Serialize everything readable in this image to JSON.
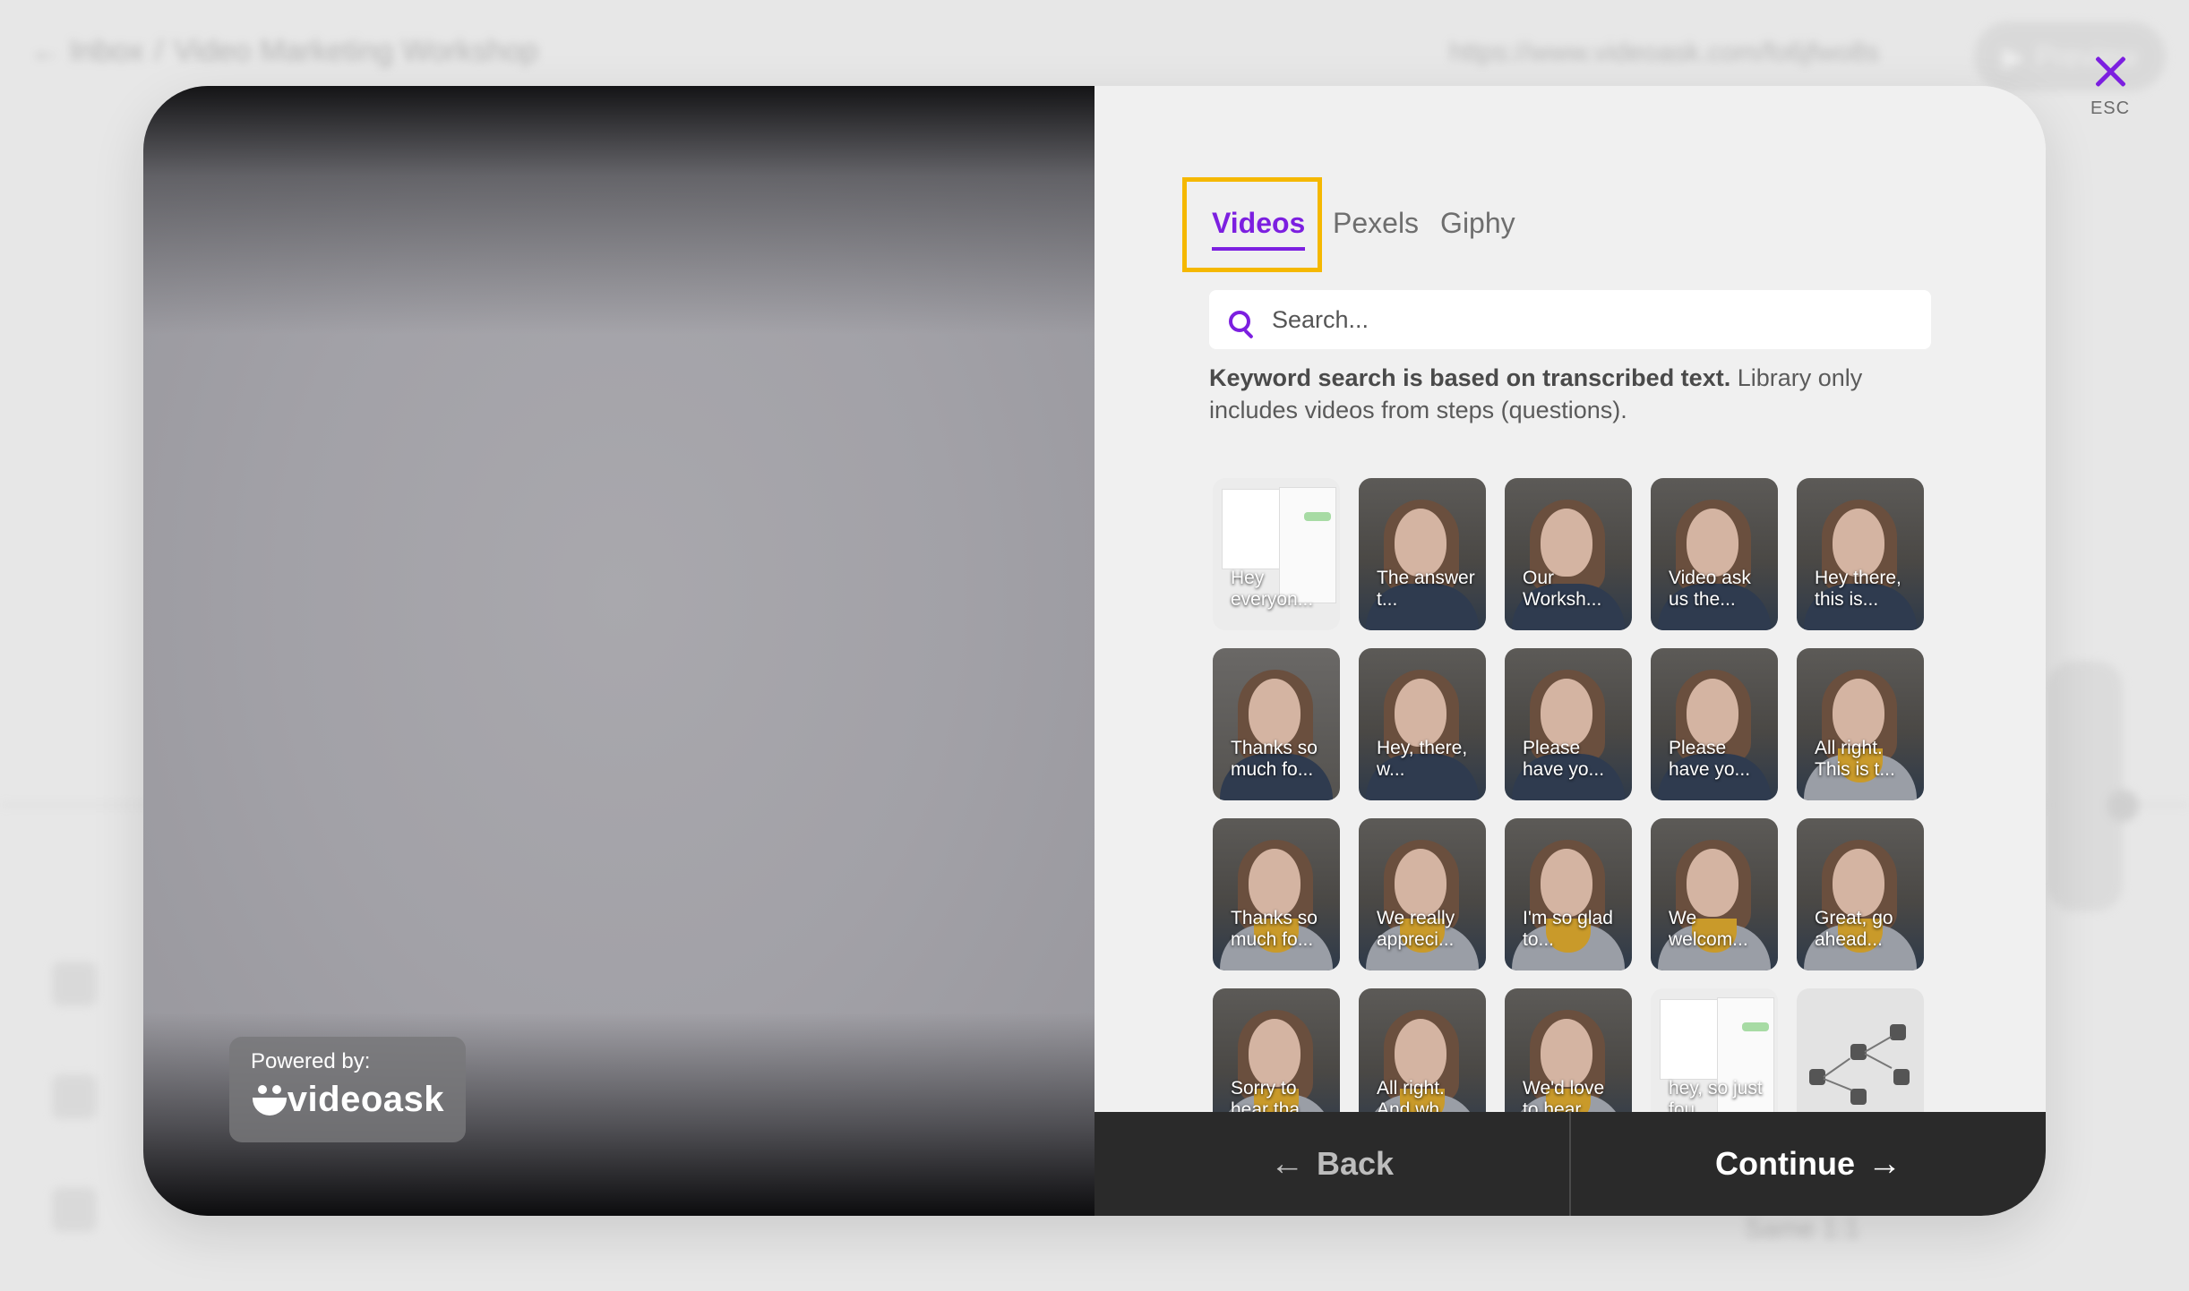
{
  "background": {
    "breadcrumb_back": "← Inbox",
    "breadcrumb_sep": "/",
    "breadcrumb_title": "Video Marketing Workshop",
    "share_url": "https://www.videoask.com/fo6jfwo8s",
    "preview_label": "Preview",
    "zoom_label": "Same 1:1"
  },
  "close": {
    "label": "ESC"
  },
  "video_pane": {
    "powered_by_label": "Powered by:",
    "brand_name": "videoask"
  },
  "tabs": [
    {
      "label": "Videos",
      "active": true
    },
    {
      "label": "Pexels",
      "active": false
    },
    {
      "label": "Giphy",
      "active": false
    }
  ],
  "search": {
    "placeholder": "Search...",
    "value": ""
  },
  "help": {
    "bold": "Keyword search is based on transcribed text.",
    "text": " Library only includes videos from steps (questions)."
  },
  "videos": [
    {
      "caption": "Hey everyon...",
      "kind": "shot"
    },
    {
      "caption": "The answer t...",
      "kind": "dark"
    },
    {
      "caption": "Our Worksh...",
      "kind": "dark"
    },
    {
      "caption": "Video ask us the...",
      "kind": "dark"
    },
    {
      "caption": "Hey there, this is...",
      "kind": "dark"
    },
    {
      "caption": "Thanks so much fo...",
      "kind": "shade"
    },
    {
      "caption": "Hey, there, w...",
      "kind": "dark"
    },
    {
      "caption": "Please have yo...",
      "kind": "dark"
    },
    {
      "caption": "Please have yo...",
      "kind": "dark"
    },
    {
      "caption": "All right. This is t...",
      "kind": "mustard"
    },
    {
      "caption": "Thanks so much fo...",
      "kind": "mustard"
    },
    {
      "caption": "We really appreci...",
      "kind": "mustard"
    },
    {
      "caption": "I'm so glad to...",
      "kind": "mustard"
    },
    {
      "caption": "We welcom...",
      "kind": "mustard"
    },
    {
      "caption": "Great, go ahead...",
      "kind": "mustard"
    },
    {
      "caption": "Sorry to hear tha...",
      "kind": "mustard"
    },
    {
      "caption": "All right. And wh...",
      "kind": "mustard"
    },
    {
      "caption": "We'd love to hear...",
      "kind": "mustard"
    },
    {
      "caption": "hey, so just fou...",
      "kind": "shot"
    },
    {
      "caption": "",
      "kind": "diagram"
    }
  ],
  "footer": {
    "back_label": "Back",
    "continue_label": "Continue"
  },
  "colors": {
    "accent": "#7c1fe0",
    "highlight_border": "#f5b800",
    "footer_bg": "#2a2a2a"
  }
}
